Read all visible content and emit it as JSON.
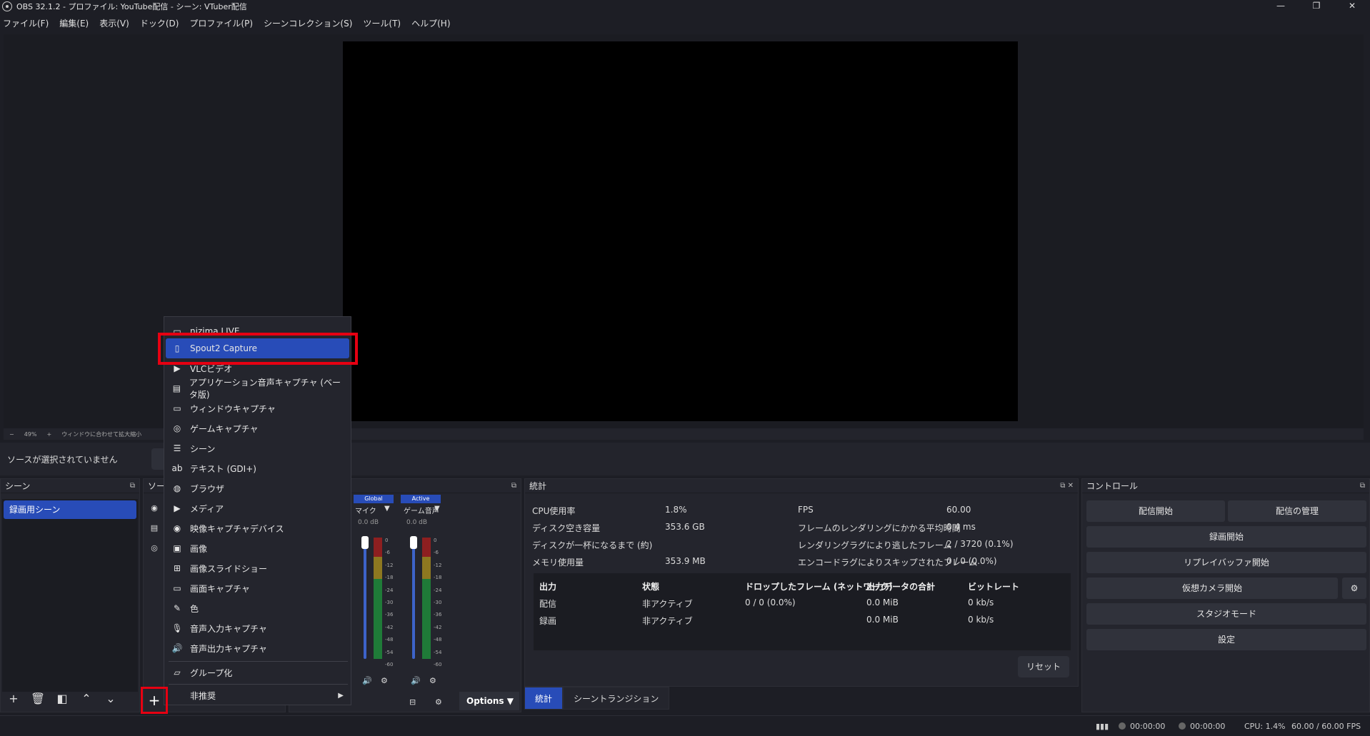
{
  "window": {
    "title": "OBS 32.1.2 - プロファイル: YouTube配信 - シーン: VTuber配信",
    "min": "—",
    "max": "❐",
    "close": "✕"
  },
  "menu": [
    "ファイル(F)",
    "編集(E)",
    "表示(V)",
    "ドック(D)",
    "プロファイル(P)",
    "シーンコレクション(S)",
    "ツール(T)",
    "ヘルプ(H)"
  ],
  "preview": {
    "zoom_minus": "−",
    "zoom_level": "49%",
    "zoom_plus": "+",
    "fit_label": "ウィンドウに合わせて拡大縮小"
  },
  "source_bar": {
    "no_source": "ソースが選択されていません"
  },
  "scenes": {
    "title": "シーン",
    "items": [
      "録画用シーン"
    ]
  },
  "sources": {
    "title": "ソース"
  },
  "mixer": {
    "tags": [
      "Global",
      "Active"
    ],
    "channels": [
      {
        "name": "マイク",
        "db": "0.0 dB"
      },
      {
        "name": "ゲーム音声",
        "db": "0.0 dB"
      }
    ],
    "scale": [
      "0",
      "-6",
      "-12",
      "-18",
      "-24",
      "-30",
      "-36",
      "-42",
      "-48",
      "-54",
      "-60"
    ],
    "options": "Options"
  },
  "stats": {
    "title": "統計",
    "rows_left": [
      {
        "label": "CPU使用率",
        "value": "1.8%"
      },
      {
        "label": "ディスク空き容量",
        "value": "353.6 GB"
      },
      {
        "label": "ディスクが一杯になるまで (約)",
        "value": ""
      },
      {
        "label": "メモリ使用量",
        "value": "353.9 MB"
      }
    ],
    "rows_right": [
      {
        "label": "FPS",
        "value": "60.00"
      },
      {
        "label": "フレームのレンダリングにかかる平均時間",
        "value": "0.4 ms"
      },
      {
        "label": "レンダリングラグにより逃したフレーム",
        "value": "2 / 3720 (0.1%)"
      },
      {
        "label": "エンコードラグによりスキップされたフレーム",
        "value": "0 / 0 (0.0%)"
      }
    ],
    "output_headers": [
      "出力",
      "状態",
      "ドロップしたフレーム (ネットワーク)",
      "出力データの合計",
      "ビットレート"
    ],
    "outputs": [
      [
        "配信",
        "非アクティブ",
        "0 / 0 (0.0%)",
        "0.0 MiB",
        "0 kb/s"
      ],
      [
        "録画",
        "非アクティブ",
        "",
        "0.0 MiB",
        "0 kb/s"
      ]
    ],
    "reset": "リセット"
  },
  "tabs": [
    "統計",
    "シーントランジション"
  ],
  "controls": {
    "title": "コントロール",
    "start_stream": "配信開始",
    "manage_stream": "配信の管理",
    "start_record": "録画開始",
    "start_replay": "リプレイバッファ開始",
    "start_vcam": "仮想カメラ開始",
    "studio_mode": "スタジオモード",
    "settings": "設定"
  },
  "status": {
    "stream_time": "00:00:00",
    "record_time": "00:00:00",
    "cpu": "CPU: 1.4%",
    "fps": "60.00 / 60.00 FPS"
  },
  "context_menu": {
    "items": [
      {
        "label": "nizima LIVE",
        "icon": "window-icon"
      },
      {
        "label": "Spout2 Capture",
        "icon": "file-icon"
      },
      {
        "label": "VLCビデオ",
        "icon": "play-icon"
      },
      {
        "label": "アプリケーション音声キャプチャ (ベータ版)",
        "icon": "app-audio-icon"
      },
      {
        "label": "ウィンドウキャプチャ",
        "icon": "window-icon"
      },
      {
        "label": "ゲームキャプチャ",
        "icon": "gamepad-icon"
      },
      {
        "label": "シーン",
        "icon": "list-icon"
      },
      {
        "label": "テキスト (GDI+)",
        "icon": "text-icon"
      },
      {
        "label": "ブラウザ",
        "icon": "globe-icon"
      },
      {
        "label": "メディア",
        "icon": "play-icon"
      },
      {
        "label": "映像キャプチャデバイス",
        "icon": "camera-icon"
      },
      {
        "label": "画像",
        "icon": "image-icon"
      },
      {
        "label": "画像スライドショー",
        "icon": "slideshow-icon"
      },
      {
        "label": "画面キャプチャ",
        "icon": "monitor-icon"
      },
      {
        "label": "色",
        "icon": "brush-icon"
      },
      {
        "label": "音声入力キャプチャ",
        "icon": "microphone-icon"
      },
      {
        "label": "音声出力キャプチャ",
        "icon": "speaker-icon"
      }
    ],
    "group": "グループ化",
    "deprecated": "非推奨"
  }
}
